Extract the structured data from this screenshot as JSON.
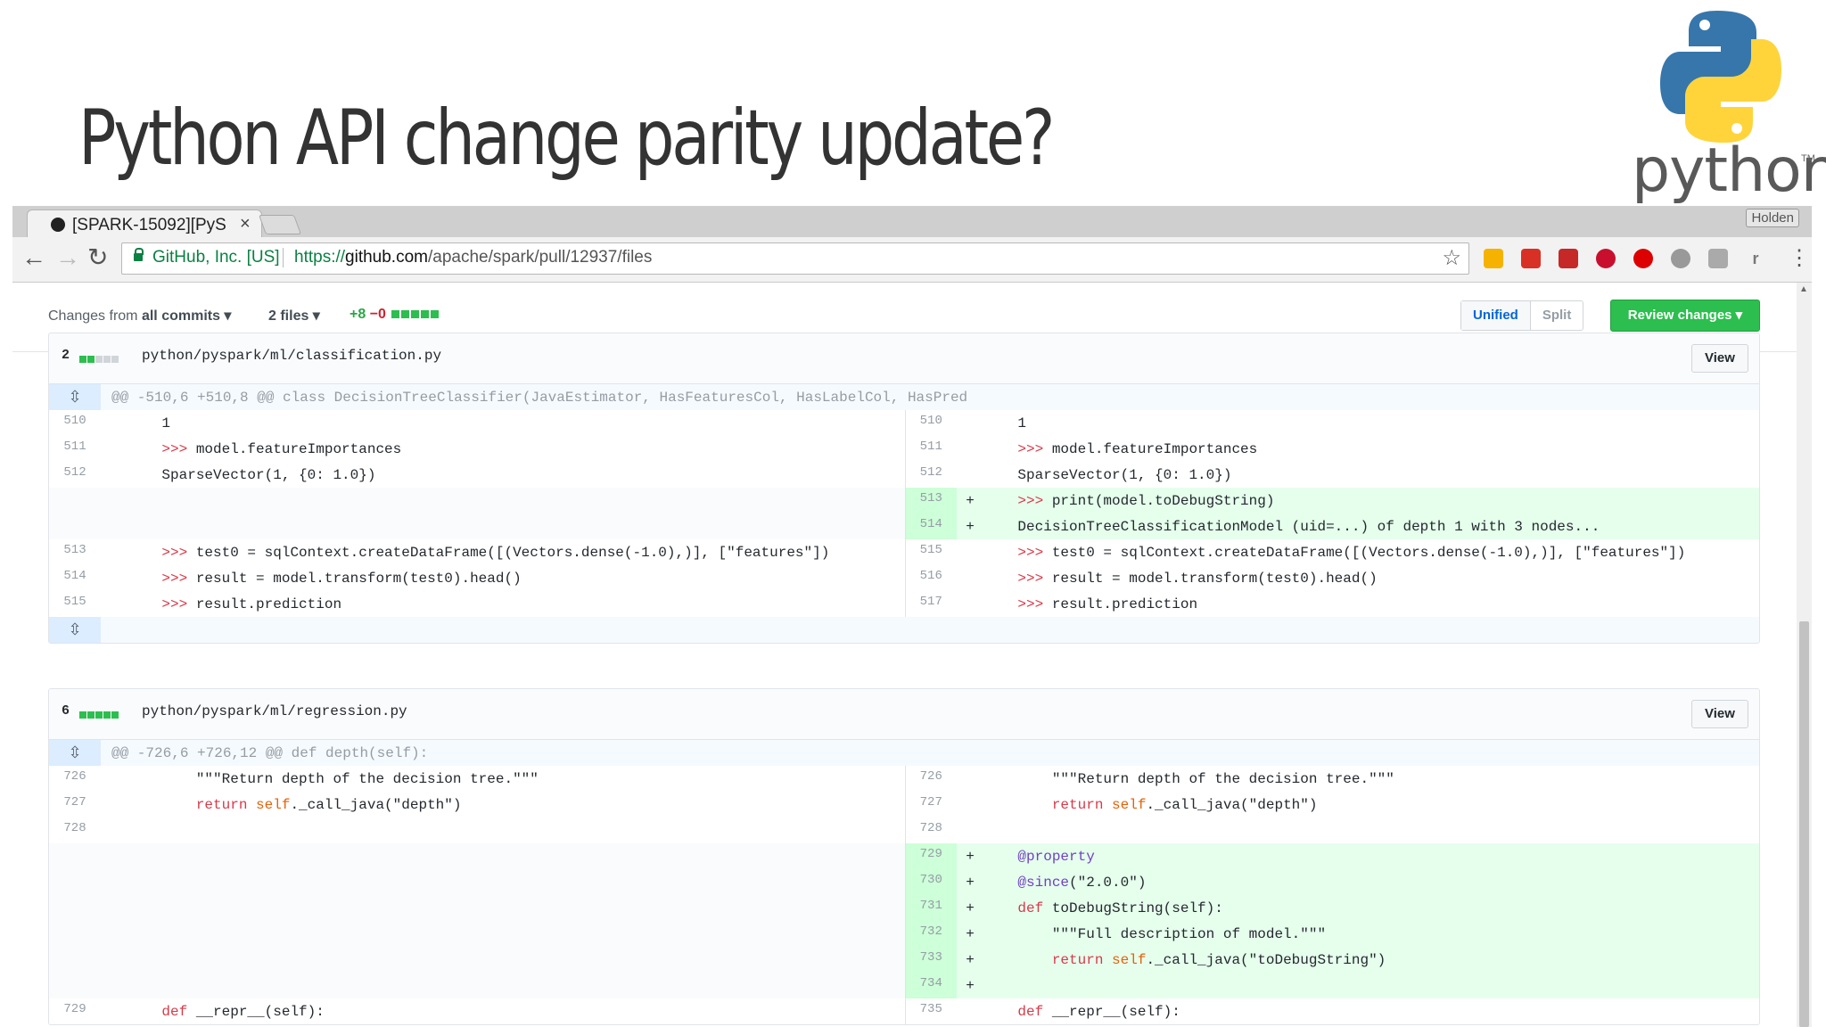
{
  "slide": {
    "title": "Python API change parity update?",
    "logo_word": "python",
    "logo_tm": "TM"
  },
  "browser": {
    "tab_title": "[SPARK-15092][PyS",
    "tab_close": "×",
    "profile_name": "Holden",
    "back": "←",
    "forward": "→",
    "reload": "↻",
    "secure_label": "GitHub, Inc. [US]",
    "url_scheme": "https://",
    "url_host": "github.com",
    "url_path": "/apache/spark/pull/12937/files",
    "bookmark_star": "☆",
    "ext_menu": "⋮"
  },
  "pr_toolbar": {
    "changes_prefix": "Changes from",
    "changes_value": "all commits ▾",
    "files_label": "2 files ▾",
    "additions": "+8",
    "deletions": "−0",
    "unified_label": "Unified",
    "split_label": "Split",
    "review_label": "Review changes ▾"
  },
  "files": [
    {
      "count": "2",
      "path": "python/pyspark/ml/classification.py",
      "view_label": "View",
      "hunk_header": "@@ -510,6 +510,8 @@ class DecisionTreeClassifier(JavaEstimator, HasFeaturesCol, HasLabelCol, HasPred",
      "rows": [
        {
          "ln": "510",
          "l": "    1",
          "rn": "510",
          "r": "    1"
        },
        {
          "ln": "511",
          "l": "    >>> model.featureImportances",
          "rn": "511",
          "r": "    >>> model.featureImportances"
        },
        {
          "ln": "512",
          "l": "    SparseVector(1, {0: 1.0})",
          "rn": "512",
          "r": "    SparseVector(1, {0: 1.0})"
        },
        {
          "ln": "",
          "l": "",
          "rn": "513",
          "mk": "+",
          "r": "    >>> print(model.toDebugString)",
          "added": true
        },
        {
          "ln": "",
          "l": "",
          "rn": "514",
          "mk": "+",
          "r": "    DecisionTreeClassificationModel (uid=...) of depth 1 with 3 nodes...",
          "added": true
        },
        {
          "ln": "513",
          "l": "    >>> test0 = sqlContext.createDataFrame([(Vectors.dense(-1.0),)], [\"features\"])",
          "rn": "515",
          "r": "    >>> test0 = sqlContext.createDataFrame([(Vectors.dense(-1.0),)], [\"features\"])"
        },
        {
          "ln": "514",
          "l": "    >>> result = model.transform(test0).head()",
          "rn": "516",
          "r": "    >>> result = model.transform(test0).head()"
        },
        {
          "ln": "515",
          "l": "    >>> result.prediction",
          "rn": "517",
          "r": "    >>> result.prediction"
        }
      ]
    },
    {
      "count": "6",
      "path": "python/pyspark/ml/regression.py",
      "view_label": "View",
      "hunk_header": "@@ -726,6 +726,12 @@ def depth(self):",
      "rows": [
        {
          "ln": "726",
          "l": "        \"\"\"Return depth of the decision tree.\"\"\"",
          "rn": "726",
          "r": "        \"\"\"Return depth of the decision tree.\"\"\""
        },
        {
          "ln": "727",
          "l": "        return self._call_java(\"depth\")",
          "rn": "727",
          "r": "        return self._call_java(\"depth\")"
        },
        {
          "ln": "728",
          "l": "",
          "rn": "728",
          "r": ""
        },
        {
          "ln": "",
          "l": "",
          "rn": "729",
          "mk": "+",
          "r": "    @property",
          "added": true
        },
        {
          "ln": "",
          "l": "",
          "rn": "730",
          "mk": "+",
          "r": "    @since(\"2.0.0\")",
          "added": true
        },
        {
          "ln": "",
          "l": "",
          "rn": "731",
          "mk": "+",
          "r": "    def toDebugString(self):",
          "added": true
        },
        {
          "ln": "",
          "l": "",
          "rn": "732",
          "mk": "+",
          "r": "        \"\"\"Full description of model.\"\"\"",
          "added": true
        },
        {
          "ln": "",
          "l": "",
          "rn": "733",
          "mk": "+",
          "r": "        return self._call_java(\"toDebugString\")",
          "added": true
        },
        {
          "ln": "",
          "l": "",
          "rn": "734",
          "mk": "+",
          "r": "",
          "added": true
        },
        {
          "ln": "729",
          "l": "    def __repr__(self):",
          "rn": "735",
          "r": "    def __repr__(self):"
        }
      ]
    }
  ],
  "colors": {
    "add_bg": "#e6ffed",
    "add_num_bg": "#cdffd8",
    "review_green": "#2cbe4e",
    "link_blue": "#0366d6"
  }
}
